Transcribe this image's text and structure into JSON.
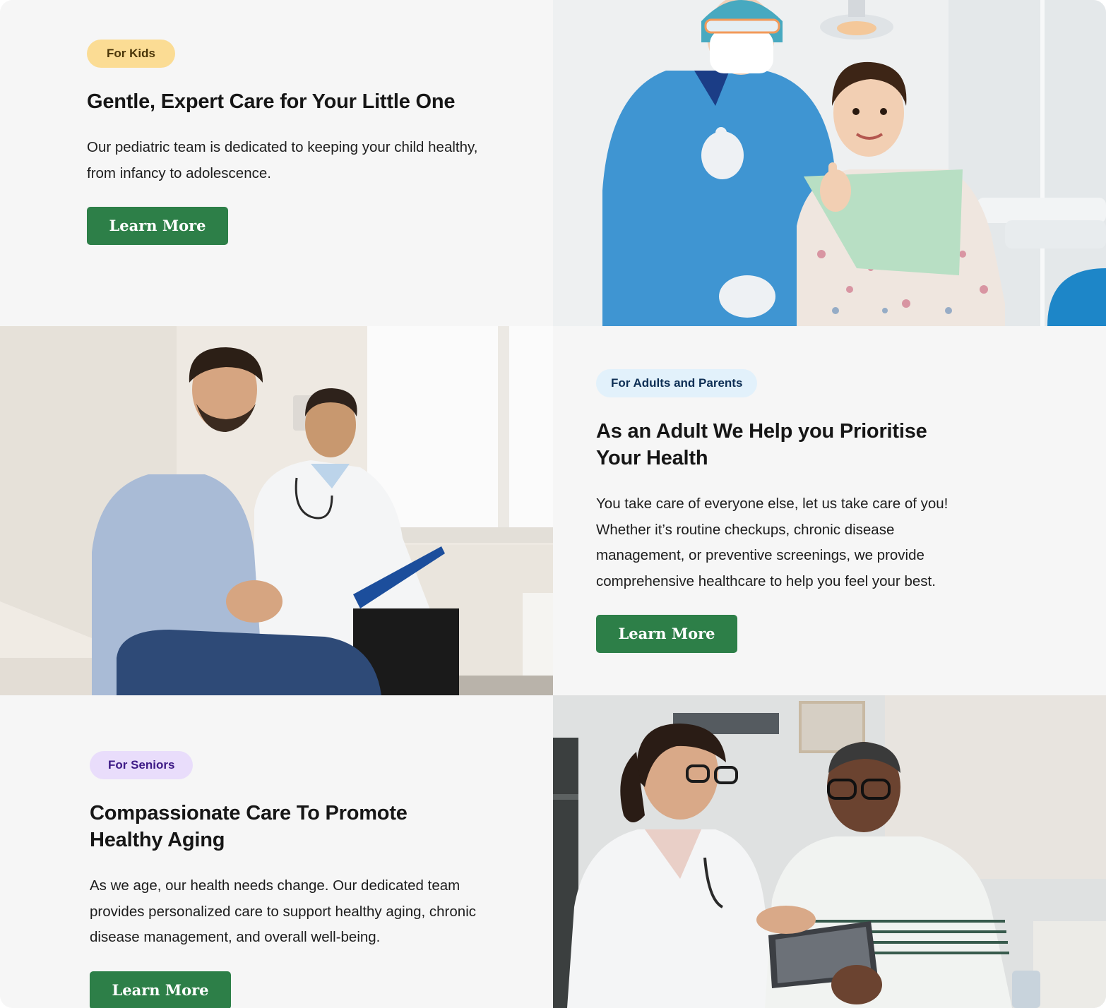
{
  "sections": [
    {
      "badge": "For Kids",
      "title": "Gentle, Expert Care for Your Little One",
      "description": "Our pediatric team is dedicated to keeping your child healthy, from infancy to adolescence.",
      "button_label": "Learn More"
    },
    {
      "badge": "For Adults and Parents",
      "title": "As an Adult We Help you Prioritise Your Health",
      "description": "You take care of everyone else, let us take care of you! Whether it’s routine checkups, chronic disease management, or preventive screenings, we provide comprehensive healthcare to help you feel your best.",
      "button_label": "Learn More"
    },
    {
      "badge": "For Seniors",
      "title": "Compassionate Care To Promote Healthy Aging",
      "description": "As we age, our health needs change. Our dedicated team provides personalized care to support healthy aging, chronic disease management, and overall well-being.",
      "button_label": "Learn More"
    }
  ],
  "colors": {
    "background": "#f6f6f6",
    "button": "#2d7f48",
    "badge_kids": "#fbdc94",
    "badge_adults": "#e2f1fb",
    "badge_seniors": "#e9ddfb"
  }
}
